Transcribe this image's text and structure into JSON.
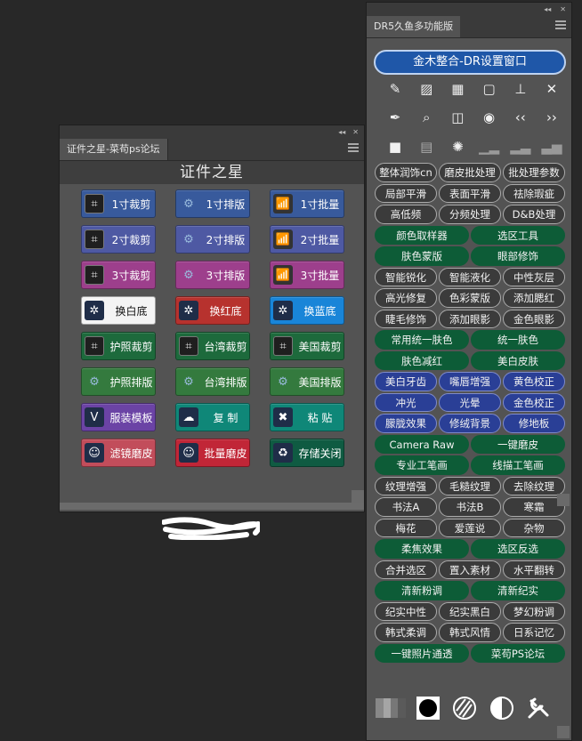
{
  "left_panel": {
    "tab_title": "证件之星-菜苟ps论坛",
    "header": "证件之星",
    "buttons": [
      {
        "label": "1寸裁剪",
        "icon": "crop-icon"
      },
      {
        "label": "1寸排版",
        "icon": "gears-icon"
      },
      {
        "label": "1寸批量",
        "icon": "chart-icon"
      },
      {
        "label": "2寸裁剪",
        "icon": "crop-icon"
      },
      {
        "label": "2寸排版",
        "icon": "gears-icon"
      },
      {
        "label": "2寸批量",
        "icon": "chart-icon"
      },
      {
        "label": "3寸裁剪",
        "icon": "crop-icon"
      },
      {
        "label": "3寸排版",
        "icon": "gears-icon"
      },
      {
        "label": "3寸批量",
        "icon": "chart-icon"
      },
      {
        "label": "换白底",
        "icon": "film-reel-icon"
      },
      {
        "label": "换红底",
        "icon": "film-reel-icon"
      },
      {
        "label": "换蓝底",
        "icon": "film-reel-icon"
      },
      {
        "label": "护照裁剪",
        "icon": "crop-icon"
      },
      {
        "label": "台湾裁剪",
        "icon": "crop-icon"
      },
      {
        "label": "美国裁剪",
        "icon": "crop-icon"
      },
      {
        "label": "护照排版",
        "icon": "gears-icon"
      },
      {
        "label": "台湾排版",
        "icon": "gears-icon"
      },
      {
        "label": "美国排版",
        "icon": "gears-icon"
      },
      {
        "label": "服装模板",
        "icon": "v-badge-icon"
      },
      {
        "label": "复 制",
        "icon": "cloud-icon"
      },
      {
        "label": "粘 贴",
        "icon": "x-tools-icon"
      },
      {
        "label": "滤镜磨皮",
        "icon": "person-icon"
      },
      {
        "label": "批量磨皮",
        "icon": "person-icon"
      },
      {
        "label": "存储关闭",
        "icon": "save-close-icon"
      }
    ]
  },
  "right_panel": {
    "tab_title": "DR5久鱼多功能版",
    "main_button": "金木整合-DR设置窗口",
    "rows": [
      [
        {
          "l": "整体润饰cn",
          "s": "dark"
        },
        {
          "l": "磨皮批处理",
          "s": "dark"
        },
        {
          "l": "批处理参数",
          "s": "dark"
        }
      ],
      [
        {
          "l": "局部平滑",
          "s": "dark"
        },
        {
          "l": "表面平滑",
          "s": "dark"
        },
        {
          "l": "祛除瑕疵",
          "s": "dark"
        }
      ],
      [
        {
          "l": "高低频",
          "s": "dark"
        },
        {
          "l": "分频处理",
          "s": "dark"
        },
        {
          "l": "D&B处理",
          "s": "dark"
        }
      ],
      [
        {
          "l": "颜色取样器",
          "s": "green"
        },
        {
          "l": "选区工具",
          "s": "green"
        }
      ],
      [
        {
          "l": "肤色蒙版",
          "s": "green"
        },
        {
          "l": "眼部修饰",
          "s": "green"
        }
      ],
      [
        {
          "l": "智能锐化",
          "s": "dark"
        },
        {
          "l": "智能液化",
          "s": "dark"
        },
        {
          "l": "中性灰层",
          "s": "dark"
        }
      ],
      [
        {
          "l": "高光修复",
          "s": "dark"
        },
        {
          "l": "色彩蒙版",
          "s": "dark"
        },
        {
          "l": "添加腮红",
          "s": "dark"
        }
      ],
      [
        {
          "l": "睫毛修饰",
          "s": "dark"
        },
        {
          "l": "添加眼影",
          "s": "dark"
        },
        {
          "l": "金色眼影",
          "s": "dark"
        }
      ],
      [
        {
          "l": "常用统一肤色",
          "s": "green"
        },
        {
          "l": "统一肤色",
          "s": "green"
        }
      ],
      [
        {
          "l": "肤色减红",
          "s": "green"
        },
        {
          "l": "美白皮肤",
          "s": "green"
        }
      ],
      [
        {
          "l": "美白牙齿",
          "s": "navy"
        },
        {
          "l": "嘴唇增强",
          "s": "navy"
        },
        {
          "l": "黄色校正",
          "s": "navy"
        }
      ],
      [
        {
          "l": "冲光",
          "s": "navy"
        },
        {
          "l": "光晕",
          "s": "navy"
        },
        {
          "l": "金色校正",
          "s": "navy"
        }
      ],
      [
        {
          "l": "朦胧效果",
          "s": "navy"
        },
        {
          "l": "修绒背景",
          "s": "navy"
        },
        {
          "l": "修地板",
          "s": "navy"
        }
      ],
      [
        {
          "l": "Camera Raw",
          "s": "green"
        },
        {
          "l": "一键磨皮",
          "s": "green"
        }
      ],
      [
        {
          "l": "专业工笔画",
          "s": "green"
        },
        {
          "l": "线描工笔画",
          "s": "green"
        }
      ],
      [
        {
          "l": "纹理增强",
          "s": "dark"
        },
        {
          "l": "毛糙纹理",
          "s": "dark"
        },
        {
          "l": "去除纹理",
          "s": "dark"
        }
      ],
      [
        {
          "l": "书法A",
          "s": "dark"
        },
        {
          "l": "书法B",
          "s": "dark"
        },
        {
          "l": "寒霜",
          "s": "dark"
        }
      ],
      [
        {
          "l": "梅花",
          "s": "dark"
        },
        {
          "l": "爱莲说",
          "s": "dark"
        },
        {
          "l": "杂物",
          "s": "dark"
        }
      ],
      [
        {
          "l": "柔焦效果",
          "s": "green"
        },
        {
          "l": "选区反选",
          "s": "green"
        }
      ],
      [
        {
          "l": "合并选区",
          "s": "dark"
        },
        {
          "l": "置入素材",
          "s": "dark"
        },
        {
          "l": "水平翻转",
          "s": "dark"
        }
      ],
      [
        {
          "l": "清新粉调",
          "s": "green"
        },
        {
          "l": "清新纪实",
          "s": "green"
        }
      ],
      [
        {
          "l": "纪实中性",
          "s": "dark"
        },
        {
          "l": "纪实黑白",
          "s": "dark"
        },
        {
          "l": "梦幻粉调",
          "s": "dark"
        }
      ],
      [
        {
          "l": "韩式柔调",
          "s": "dark"
        },
        {
          "l": "韩式风情",
          "s": "dark"
        },
        {
          "l": "日系记忆",
          "s": "dark"
        }
      ],
      [
        {
          "l": "一键照片通透",
          "s": "green"
        },
        {
          "l": "菜苟PS论坛",
          "s": "green"
        }
      ]
    ]
  }
}
